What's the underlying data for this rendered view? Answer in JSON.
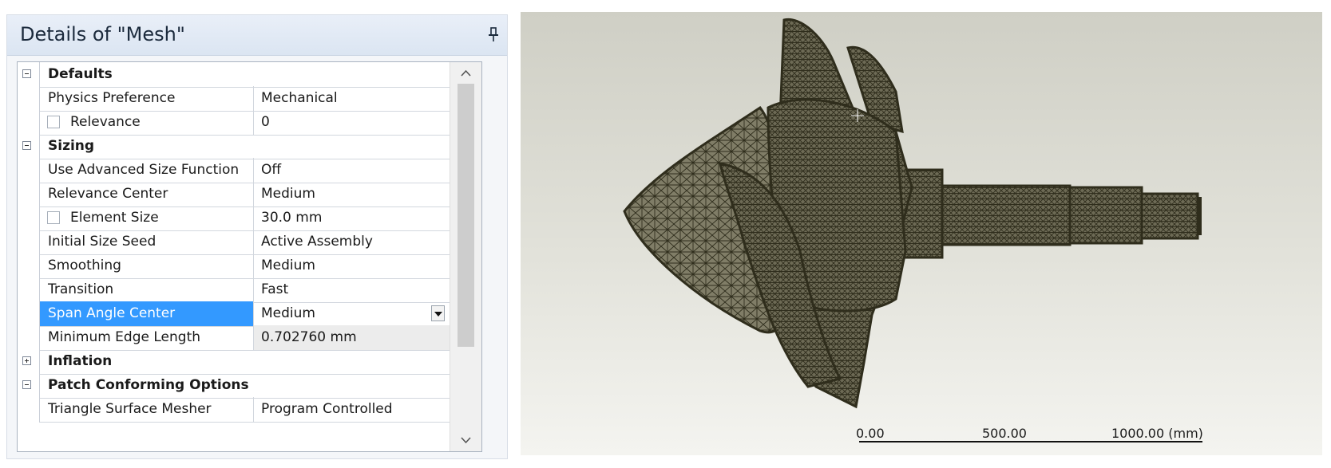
{
  "panel": {
    "title": "Details of \"Mesh\"",
    "pin_icon": "pin-icon"
  },
  "grid": {
    "categories": {
      "defaults": {
        "label": "Defaults",
        "expanded": true
      },
      "sizing": {
        "label": "Sizing",
        "expanded": true
      },
      "inflation": {
        "label": "Inflation",
        "expanded": false
      },
      "patch": {
        "label": "Patch Conforming Options",
        "expanded": true
      }
    },
    "rows": {
      "physics_preference": {
        "name": "Physics Preference",
        "value": "Mechanical"
      },
      "relevance": {
        "name": "Relevance",
        "value": "0",
        "checked": false
      },
      "use_advanced_size_function": {
        "name": "Use Advanced Size Function",
        "value": "Off"
      },
      "relevance_center": {
        "name": "Relevance Center",
        "value": "Medium"
      },
      "element_size": {
        "name": "Element Size",
        "value": "30.0 mm",
        "checked": false
      },
      "initial_size_seed": {
        "name": "Initial Size Seed",
        "value": "Active Assembly"
      },
      "smoothing": {
        "name": "Smoothing",
        "value": "Medium"
      },
      "transition": {
        "name": "Transition",
        "value": "Fast"
      },
      "span_angle_center": {
        "name": "Span Angle Center",
        "value": "Medium",
        "selected": true
      },
      "minimum_edge_length": {
        "name": "Minimum Edge Length",
        "value": "0.702760 mm",
        "readonly": true
      },
      "triangle_surface_mesher": {
        "name": "Triangle Surface Mesher",
        "value": "Program Controlled"
      }
    },
    "selection_color": "#3399ff"
  },
  "viewport": {
    "background_top": "#cfcfc5",
    "background_bottom": "#f4f4f0",
    "mesh_color": "#2f2d1c",
    "scale_bar": {
      "tick_0": "0.00",
      "tick_1": "500.00",
      "tick_2": "1000.00 (mm)"
    }
  }
}
